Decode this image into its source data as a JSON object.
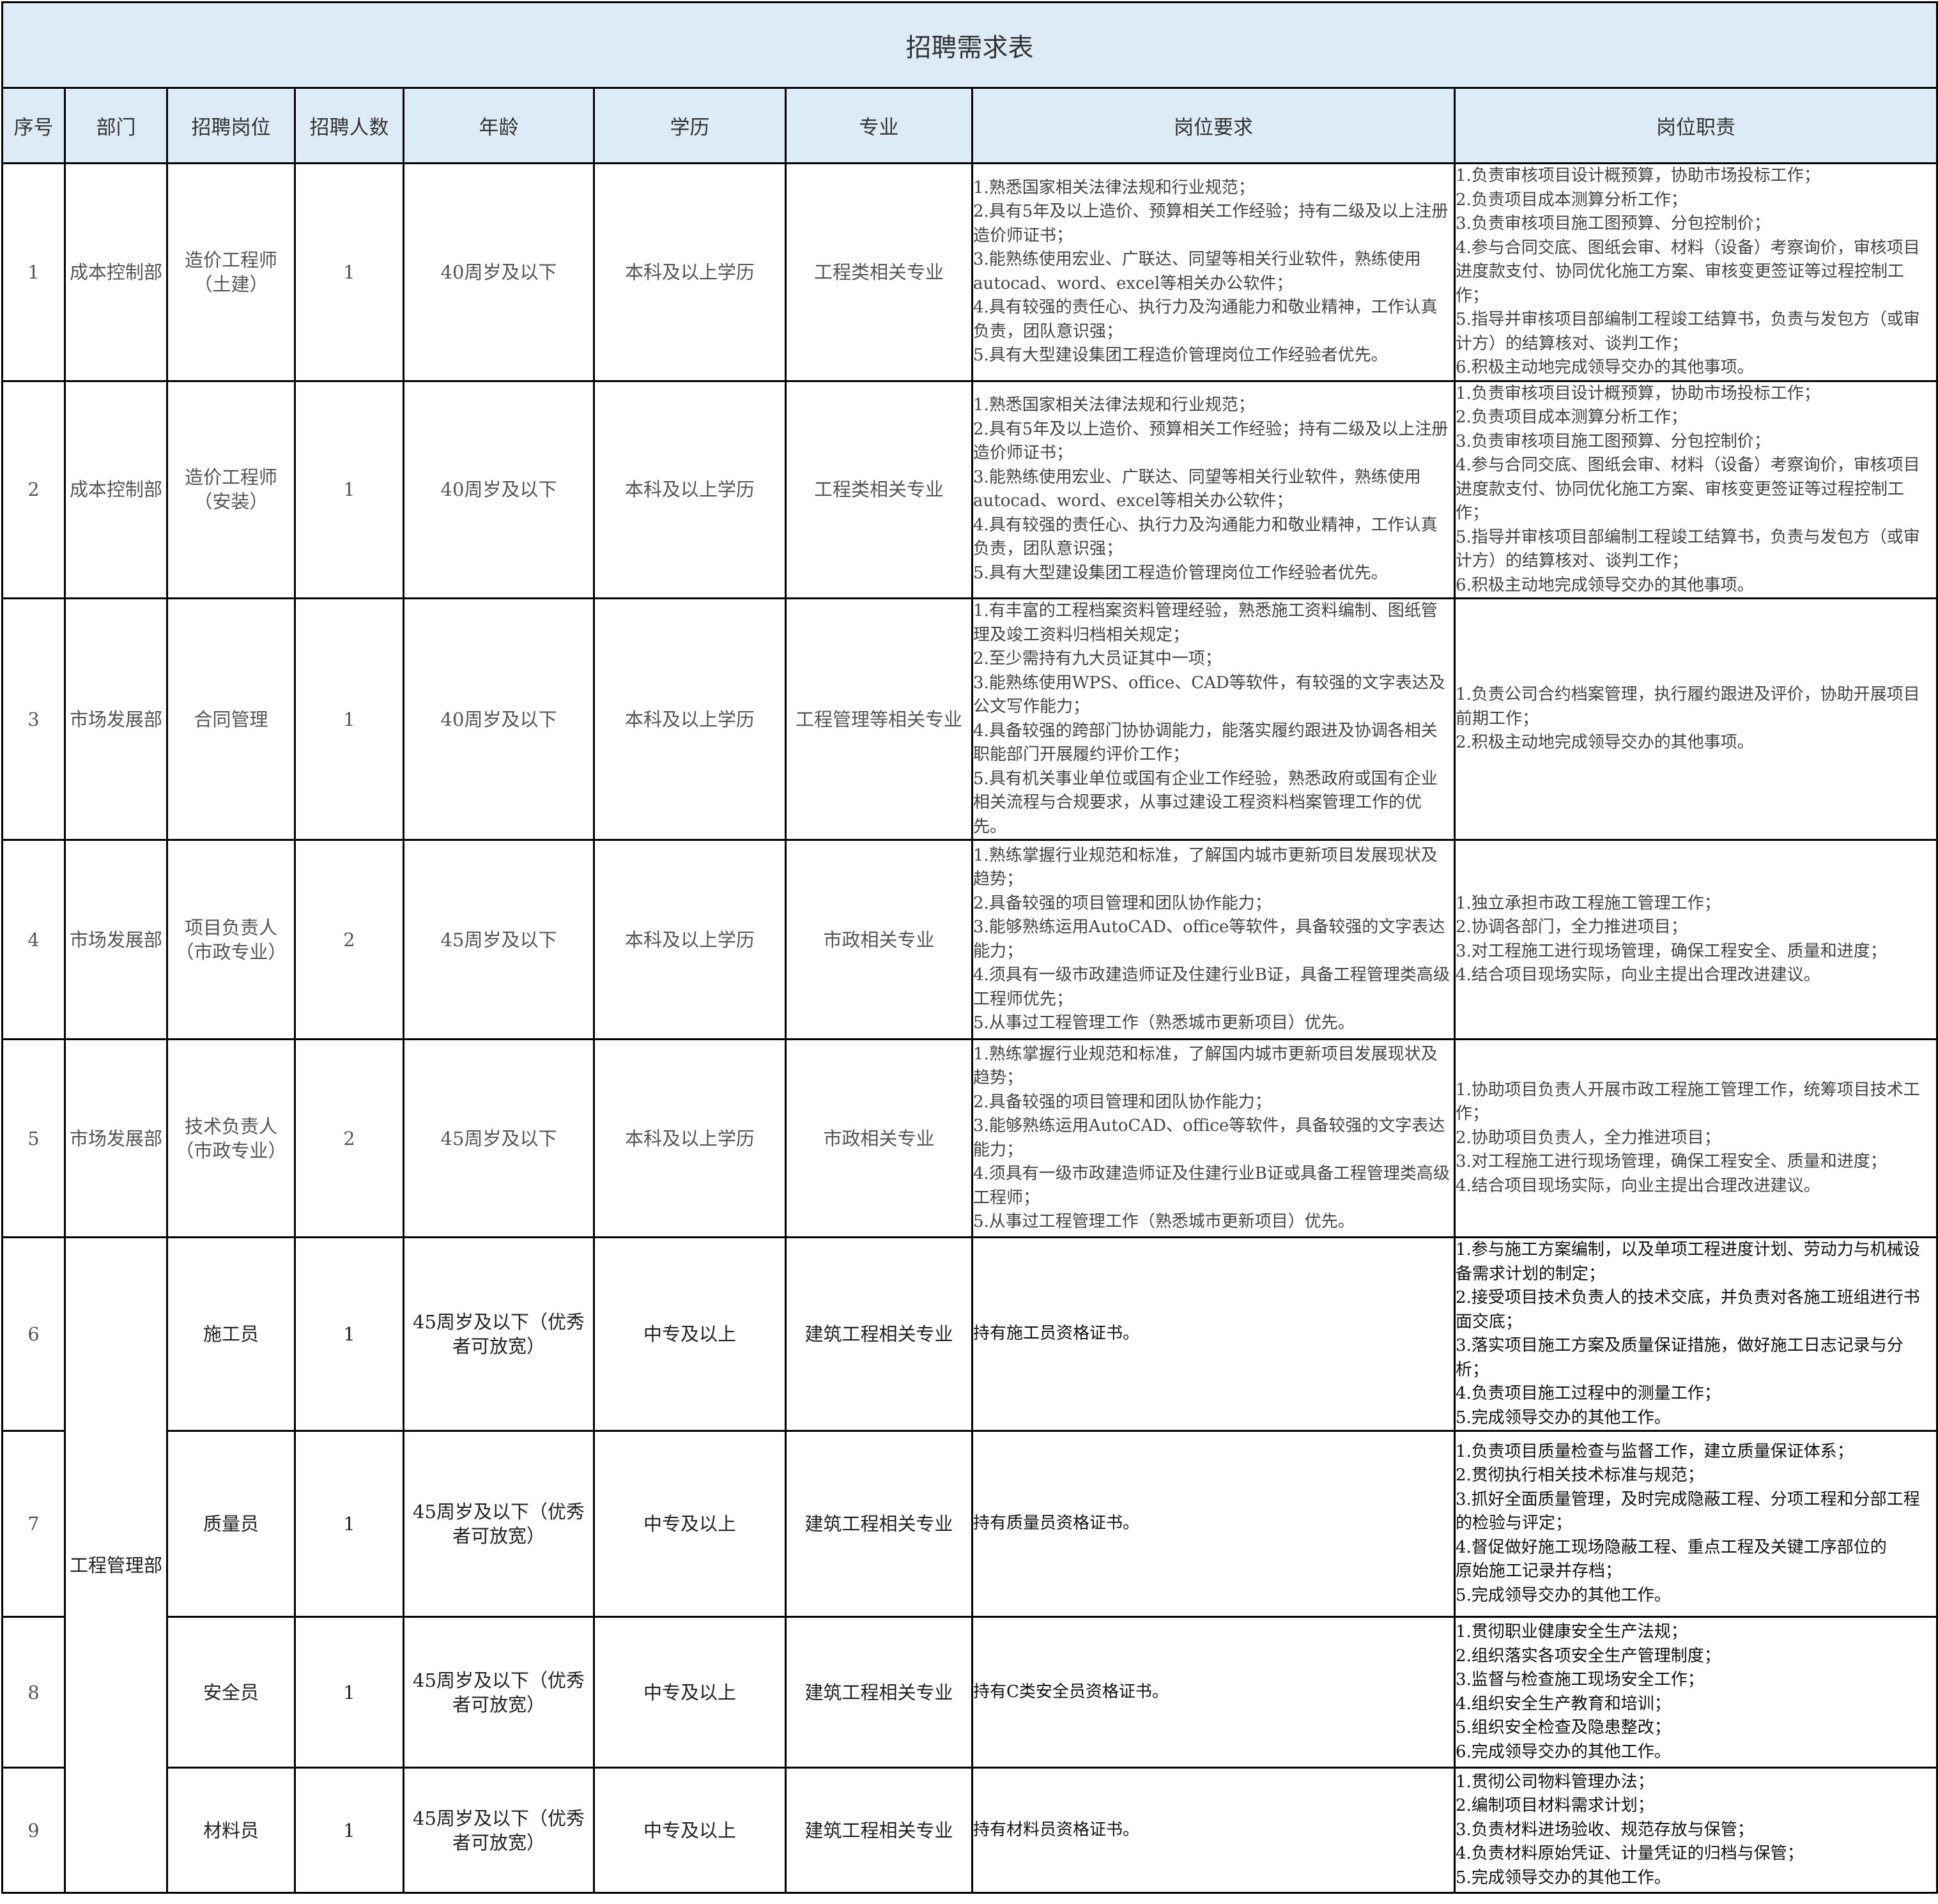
{
  "title": "招聘需求表",
  "headers": [
    "序号",
    "部门",
    "招聘岗位",
    "招聘人数",
    "年龄",
    "学历",
    "专业",
    "岗位要求",
    "岗位职责"
  ],
  "rows": [
    {
      "no": "1",
      "dept": "成本控制部",
      "position": "造价工程师（土建）",
      "count": "1",
      "age": "40周岁及以下",
      "edu": "本科及以上学历",
      "major": "工程类相关专业",
      "req": "1.熟悉国家相关法律法规和行业规范；\n2.具有5年及以上造价、预算相关工作经验；持有二级及以上注册造价师证书；\n3.能熟练使用宏业、广联达、同望等相关行业软件，熟练使用autocad、word、excel等相关办公软件；\n4.具有较强的责任心、执行力及沟通能力和敬业精神，工作认真负责，团队意识强；\n5.具有大型建设集团工程造价管理岗位工作经验者优先。",
      "duty": "1.负责审核项目设计概预算，协助市场投标工作；\n2.负责项目成本测算分析工作；\n3.负责审核项目施工图预算、分包控制价；\n4.参与合同交底、图纸会审、材料（设备）考察询价，审核项目进度款支付、协同优化施工方案、审核变更签证等过程控制工作；\n5.指导并审核项目部编制工程竣工结算书，负责与发包方（或审计方）的结算核对、谈判工作；\n6.积极主动地完成领导交办的其他事项。"
    },
    {
      "no": "2",
      "dept": "成本控制部",
      "position": "造价工程师（安装）",
      "count": "1",
      "age": "40周岁及以下",
      "edu": "本科及以上学历",
      "major": "工程类相关专业",
      "req": "1.熟悉国家相关法律法规和行业规范；\n2.具有5年及以上造价、预算相关工作经验；持有二级及以上注册造价师证书；\n3.能熟练使用宏业、广联达、同望等相关行业软件，熟练使用autocad、word、excel等相关办公软件；\n4.具有较强的责任心、执行力及沟通能力和敬业精神，工作认真负责，团队意识强；\n5.具有大型建设集团工程造价管理岗位工作经验者优先。",
      "duty": "1.负责审核项目设计概预算，协助市场投标工作；\n2.负责项目成本测算分析工作；\n3.负责审核项目施工图预算、分包控制价；\n4.参与合同交底、图纸会审、材料（设备）考察询价，审核项目进度款支付、协同优化施工方案、审核变更签证等过程控制工作；\n5.指导并审核项目部编制工程竣工结算书，负责与发包方（或审计方）的结算核对、谈判工作；\n6.积极主动地完成领导交办的其他事项。"
    },
    {
      "no": "3",
      "dept": "市场发展部",
      "position": "合同管理",
      "count": "1",
      "age": "40周岁及以下",
      "edu": "本科及以上学历",
      "major": "工程管理等相关专业",
      "req": "1.有丰富的工程档案资料管理经验，熟悉施工资料编制、图纸管理及竣工资料归档相关规定；\n2.至少需持有九大员证其中一项；\n3.能熟练使用WPS、office、CAD等软件，有较强的文字表达及公文写作能力；\n4.具备较强的跨部门协协调能力，能落实履约跟进及协调各相关职能部门开展履约评价工作；\n5.具有机关事业单位或国有企业工作经验，熟悉政府或国有企业相关流程与合规要求，从事过建设工程资料档案管理工作的优先。",
      "duty": "1.负责公司合约档案管理，执行履约跟进及评价，协助开展项目前期工作；\n2.积极主动地完成领导交办的其他事项。"
    },
    {
      "no": "4",
      "dept": "市场发展部",
      "position": "项目负责人（市政专业）",
      "count": "2",
      "age": "45周岁及以下",
      "edu": "本科及以上学历",
      "major": "市政相关专业",
      "req": "1.熟练掌握行业规范和标准，了解国内城市更新项目发展现状及趋势；\n2.具备较强的项目管理和团队协作能力；\n3.能够熟练运用AutoCAD、office等软件，具备较强的文字表达能力；\n4.须具有一级市政建造师证及住建行业B证，具备工程管理类高级工程师优先；\n5.从事过工程管理工作（熟悉城市更新项目）优先。",
      "duty": "1.独立承担市政工程施工管理工作；\n2.协调各部门，全力推进项目；\n3.对工程施工进行现场管理，确保工程安全、质量和进度；\n4.结合项目现场实际，向业主提出合理改进建议。"
    },
    {
      "no": "5",
      "dept": "市场发展部",
      "position": "技术负责人（市政专业）",
      "count": "2",
      "age": "45周岁及以下",
      "edu": "本科及以上学历",
      "major": "市政相关专业",
      "req": "1.熟练掌握行业规范和标准，了解国内城市更新项目发展现状及趋势；\n2.具备较强的项目管理和团队协作能力；\n3.能够熟练运用AutoCAD、office等软件，具备较强的文字表达能力；\n4.须具有一级市政建造师证及住建行业B证或具备工程管理类高级工程师；\n5.从事过工程管理工作（熟悉城市更新项目）优先。",
      "duty": "1.协助项目负责人开展市政工程施工管理工作，统筹项目技术工作；\n2.协助项目负责人，全力推进项目；\n3.对工程施工进行现场管理，确保工程安全、质量和进度；\n4.结合项目现场实际，向业主提出合理改进建议。"
    },
    {
      "no": "6",
      "dept": "工程管理部",
      "position": "施工员",
      "count": "1",
      "age": "45周岁及以下（优秀者可放宽）",
      "edu": "中专及以上",
      "major": "建筑工程相关专业",
      "req": "持有施工员资格证书。",
      "duty": "1.参与施工方案编制，以及单项工程进度计划、劳动力与机械设备需求计划的制定；\n2.接受项目技术负责人的技术交底，并负责对各施工班组进行书面交底；\n3.落实项目施工方案及质量保证措施，做好施工日志记录与分析；\n4.负责项目施工过程中的测量工作；\n5.完成领导交办的其他工作。"
    },
    {
      "no": "7",
      "dept": "",
      "position": "质量员",
      "count": "1",
      "age": "45周岁及以下（优秀者可放宽）",
      "edu": "中专及以上",
      "major": "建筑工程相关专业",
      "req": "持有质量员资格证书。",
      "duty": "1.负责项目质量检查与监督工作，建立质量保证体系；\n2.贯彻执行相关技术标准与规范；\n3.抓好全面质量管理，及时完成隐蔽工程、分项工程和分部工程的检验与评定；\n4.督促做好施工现场隐蔽工程、重点工程及关键工序部位的\n原始施工记录并存档；\n5.完成领导交办的其他工作。"
    },
    {
      "no": "8",
      "dept": "",
      "position": "安全员",
      "count": "1",
      "age": "45周岁及以下（优秀者可放宽）",
      "edu": "中专及以上",
      "major": "建筑工程相关专业",
      "req": "持有C类安全员资格证书。",
      "duty": "1.贯彻职业健康安全生产法规；\n2.组织落实各项安全生产管理制度；\n3.监督与检查施工现场安全工作；\n4.组织安全生产教育和培训；\n5.组织安全检查及隐患整改；\n6.完成领导交办的其他工作。"
    },
    {
      "no": "9",
      "dept": "",
      "position": "材料员",
      "count": "1",
      "age": "45周岁及以下（优秀者可放宽）",
      "edu": "中专及以上",
      "major": "建筑工程相关专业",
      "req": "持有材料员资格证书。",
      "duty": "1.贯彻公司物料管理办法；\n2.编制项目材料需求计划；\n3.负责材料进场验收、规范存放与保管；\n4.负责材料原始凭证、计量凭证的归档与保管；\n5.完成领导交办的其他工作。"
    }
  ]
}
